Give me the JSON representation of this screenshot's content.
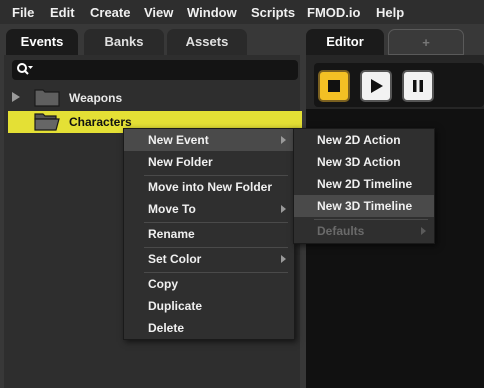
{
  "menubar": {
    "items": [
      "File",
      "Edit",
      "Create",
      "View",
      "Window",
      "Scripts",
      "FMOD.io",
      "Help"
    ]
  },
  "browser_tabs": [
    "Events",
    "Banks",
    "Assets"
  ],
  "editor_tabs": {
    "active": "Editor",
    "add": "+"
  },
  "tree": [
    {
      "label": "Weapons",
      "selected": false
    },
    {
      "label": "Characters",
      "selected": true
    }
  ],
  "context_menu": {
    "items": [
      "New Event",
      "New Folder",
      "Move into New Folder",
      "Move To",
      "Rename",
      "Set Color",
      "Copy",
      "Duplicate",
      "Delete"
    ]
  },
  "submenu": {
    "items": [
      "New 2D Action",
      "New 3D Action",
      "New 2D Timeline",
      "New 3D Timeline",
      "Defaults"
    ]
  },
  "colors": {
    "selection": "#e4e035",
    "stop_button": "#f3c024"
  }
}
